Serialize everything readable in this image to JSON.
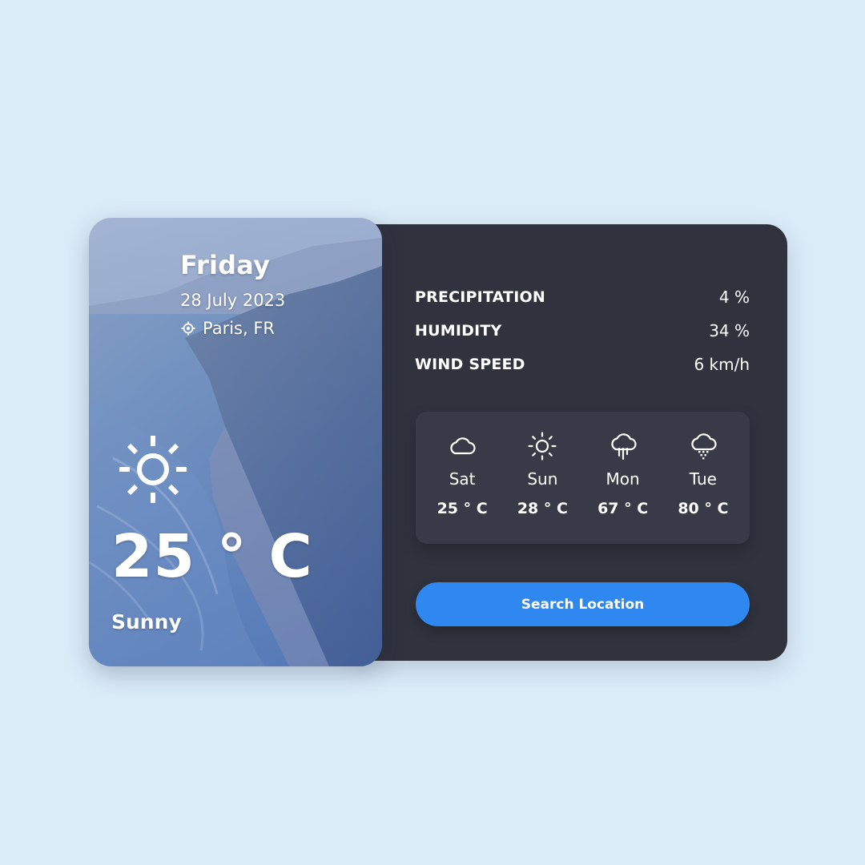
{
  "hero": {
    "day": "Friday",
    "date": "28 July 2023",
    "location": "Paris, FR",
    "temperature": "25 ° C",
    "condition": "Sunny",
    "icon": "sun-icon"
  },
  "stats": [
    {
      "label": "PRECIPITATION",
      "value": "4 %"
    },
    {
      "label": "HUMIDITY",
      "value": "34 %"
    },
    {
      "label": "WIND SPEED",
      "value": "6 km/h"
    }
  ],
  "forecast": [
    {
      "day": "Sat",
      "temp": "25 ° C",
      "icon": "cloud-icon"
    },
    {
      "day": "Sun",
      "temp": "28 ° C",
      "icon": "sun-icon"
    },
    {
      "day": "Mon",
      "temp": "67 ° C",
      "icon": "rain-cloud-icon"
    },
    {
      "day": "Tue",
      "temp": "80 ° C",
      "icon": "drizzle-cloud-icon"
    }
  ],
  "search_button": {
    "label": "Search Location"
  },
  "colors": {
    "page_background": "#dbecf9",
    "panel": "#30333e",
    "forecast_panel": "#383b47",
    "accent": "#2f88f0"
  }
}
